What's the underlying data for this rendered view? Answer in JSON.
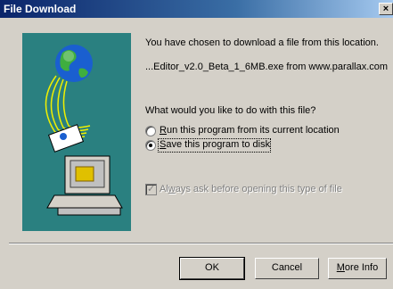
{
  "window": {
    "title": "File Download",
    "close_glyph": "×"
  },
  "message": {
    "line1": "You have chosen to download a file from this location.",
    "location": "...Editor_v2.0_Beta_1_6MB.exe from www.parallax.com",
    "question": "What would you like to do with this file?"
  },
  "options": [
    {
      "accel": "R",
      "rest": "un this program from its current location",
      "checked": false
    },
    {
      "accel": "S",
      "rest": "ave this program to disk",
      "checked": true
    }
  ],
  "always_ask": {
    "pre": "Al",
    "accel": "w",
    "post": "ays ask before opening this type of file",
    "checked": true,
    "disabled": true
  },
  "buttons": {
    "ok": "OK",
    "cancel": "Cancel",
    "more_accel": "M",
    "more_rest": "ore Info"
  },
  "colors": {
    "illustration_bg": "#2a8080",
    "titlebar": "#0a246a"
  }
}
